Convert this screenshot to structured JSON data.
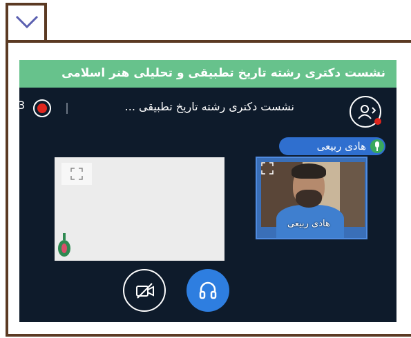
{
  "banner": {
    "text": "نشست دکتری رشته تاریخ تطبیقی و تحلیلی هنر اسلامی"
  },
  "topbar": {
    "session_title": "نشست دکتری رشته تاریخ تطبیقی ...",
    "recording_cut_text": "3"
  },
  "speaker": {
    "name": "هادی ربیعی"
  },
  "video_tile": {
    "name": "هادی ربیعی"
  },
  "colors": {
    "frame": "#5b3a23",
    "banner": "#67c28c",
    "background": "#0e1b2b",
    "accent": "#2e7ee0",
    "record": "#e0261e"
  },
  "icons": [
    "chevron-down-icon",
    "record-icon",
    "user-icon",
    "mic-icon",
    "expand-icon",
    "camera-off-icon",
    "headphones-icon"
  ]
}
